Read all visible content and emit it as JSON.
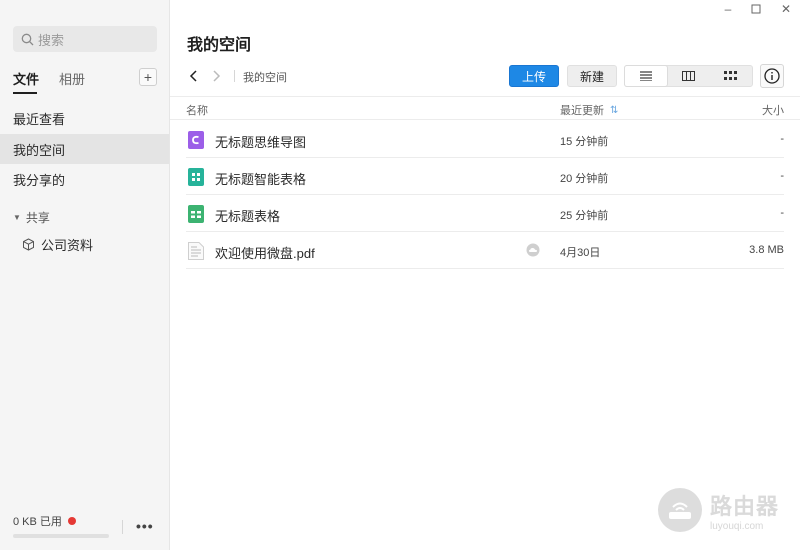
{
  "sidebar": {
    "search_placeholder": "搜索",
    "tabs": [
      {
        "label": "文件",
        "active": true
      },
      {
        "label": "相册",
        "active": false
      }
    ],
    "add_label": "+",
    "nav_items": [
      {
        "label": "最近查看"
      },
      {
        "label": "我的空间",
        "active": true
      },
      {
        "label": "我分享的"
      }
    ],
    "shared_section": {
      "label": "共享",
      "items": [
        {
          "label": "公司资料",
          "icon": "cube-icon"
        }
      ]
    },
    "storage": {
      "label": "0 KB 已用",
      "status_color": "#e53935",
      "used_fraction": 0
    },
    "more_label": "•••"
  },
  "window_controls": {
    "minimize": "–",
    "maximize": "☐",
    "close": "✕"
  },
  "main": {
    "title": "我的空间",
    "breadcrumb": "我的空间",
    "upload_label": "上传",
    "new_label": "新建",
    "view_modes": [
      {
        "name": "list",
        "active": true
      },
      {
        "name": "columns",
        "active": false
      },
      {
        "name": "grid",
        "active": false
      }
    ],
    "accent_color": "#1e88e5",
    "columns": {
      "name": "名称",
      "updated": "最近更新",
      "size": "大小"
    },
    "files": [
      {
        "name": "无标题思维导图",
        "updated": "15 分钟前",
        "size": "-",
        "icon": "mindmap-icon",
        "icon_color": "#9c5ee8"
      },
      {
        "name": "无标题智能表格",
        "updated": "20 分钟前",
        "size": "-",
        "icon": "smart-table-icon",
        "icon_color": "#26b39a"
      },
      {
        "name": "无标题表格",
        "updated": "25 分钟前",
        "size": "-",
        "icon": "spreadsheet-icon",
        "icon_color": "#3cb371"
      },
      {
        "name": "欢迎使用微盘.pdf",
        "updated": "4月30日",
        "size": "3.8 MB",
        "icon": "pdf-file-icon",
        "cloud": true
      }
    ]
  },
  "watermark": {
    "text": "路由器",
    "sub": "luyouqi.com"
  }
}
